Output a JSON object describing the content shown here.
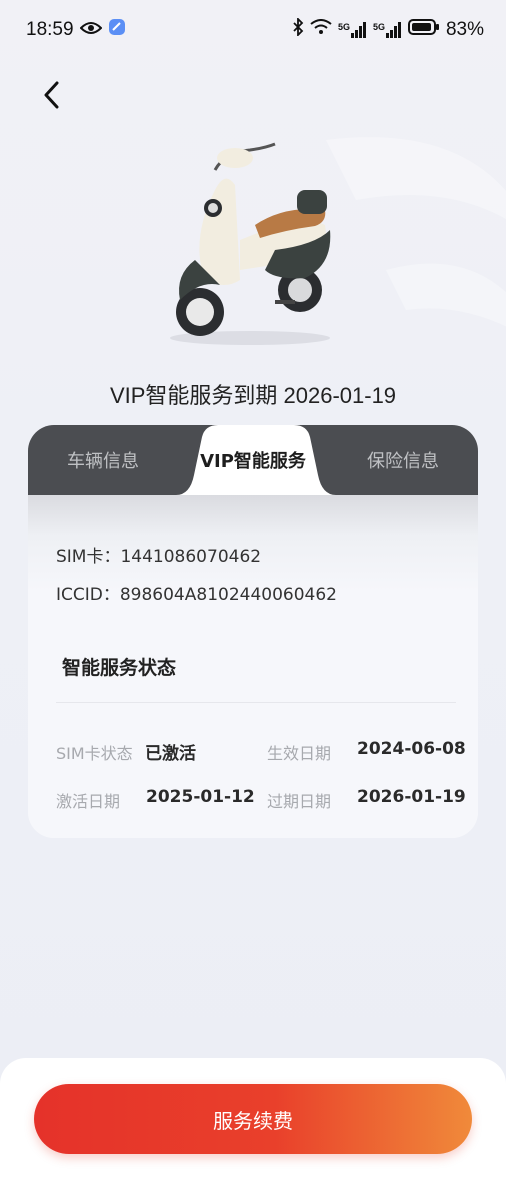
{
  "status_bar": {
    "time": "18:59",
    "battery_percent": "83%",
    "network_labels": [
      "5G",
      "5G"
    ],
    "icons": [
      "eye-icon",
      "app-badge-icon",
      "bluetooth-icon",
      "wifi-icon",
      "signal-icon",
      "signal-icon",
      "battery-icon"
    ]
  },
  "header": {
    "back_icon": "chevron-left-icon"
  },
  "vehicle": {
    "image": "scooter-photo",
    "expiry_title": "VIP智能服务到期 2026-01-19"
  },
  "tabs": [
    {
      "label": "车辆信息",
      "active": false
    },
    {
      "label": "VIP智能服务",
      "active": true
    },
    {
      "label": "保险信息",
      "active": false
    }
  ],
  "sim": {
    "sim_line": "SIM卡：1441086070462",
    "iccid_line": "ICCID：898604A8102440060462"
  },
  "service_status": {
    "title": "智能服务状态",
    "sim_status_label": "SIM卡状态",
    "sim_status_value": "已激活",
    "effective_label": "生效日期",
    "effective_value": "2024-06-08",
    "activation_label": "激活日期",
    "activation_value": "2025-01-12",
    "expiry_label": "过期日期",
    "expiry_value": "2026-01-19"
  },
  "footer": {
    "renew_button": "服务续费"
  },
  "colors": {
    "accent_start": "#e5322a",
    "accent_end": "#f08a3a",
    "tab_bar": "#4b4d51"
  }
}
